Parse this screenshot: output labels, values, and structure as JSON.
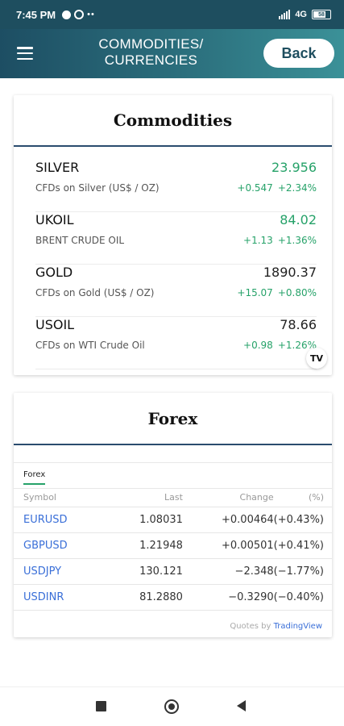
{
  "status_bar": {
    "time": "7:45 PM",
    "network": "4G",
    "battery": "58"
  },
  "app_bar": {
    "title_line1": "COMMODITIES/",
    "title_line2": "CURRENCIES",
    "back_label": "Back"
  },
  "commodities": {
    "title": "Commodities",
    "items": [
      {
        "symbol": "SILVER",
        "description": "CFDs on Silver (US$ / OZ)",
        "price": "23.956",
        "change": "+0.547",
        "change_pct": "+2.34%",
        "price_color": "#26a269"
      },
      {
        "symbol": "UKOIL",
        "description": "BRENT CRUDE OIL",
        "price": "84.02",
        "change": "+1.13",
        "change_pct": "+1.36%",
        "price_color": "#26a269"
      },
      {
        "symbol": "GOLD",
        "description": "CFDs on Gold (US$ / OZ)",
        "price": "1890.37",
        "change": "+15.07",
        "change_pct": "+0.80%",
        "price_color": "#222222"
      },
      {
        "symbol": "USOIL",
        "description": "CFDs on WTI Crude Oil",
        "price": "78.66",
        "change": "+0.98",
        "change_pct": "+1.26%",
        "price_color": "#222222"
      }
    ],
    "logo_text": "TV"
  },
  "forex": {
    "title": "Forex",
    "tab_label": "Forex",
    "columns": {
      "symbol": "Symbol",
      "last": "Last",
      "change": "Change",
      "pct": "(%)"
    },
    "rows": [
      {
        "symbol": "EURUSD",
        "last": "1.08031",
        "change": "+0.00464",
        "pct": "(+0.43%)"
      },
      {
        "symbol": "GBPUSD",
        "last": "1.21948",
        "change": "+0.00501",
        "pct": "(+0.41%)"
      },
      {
        "symbol": "USDJPY",
        "last": "130.121",
        "change": "−2.348",
        "pct": "(−1.77%)"
      },
      {
        "symbol": "USDINR",
        "last": "81.2880",
        "change": "−0.3290",
        "pct": "(−0.40%)"
      }
    ],
    "quotes_prefix": "Quotes by",
    "quotes_brand": "TradingView"
  },
  "colors": {
    "header_dark": "#1d4e63",
    "header_light": "#3b9198",
    "positive": "#26a269",
    "link": "#3a6fd8",
    "rule": "#2a4c6e"
  }
}
